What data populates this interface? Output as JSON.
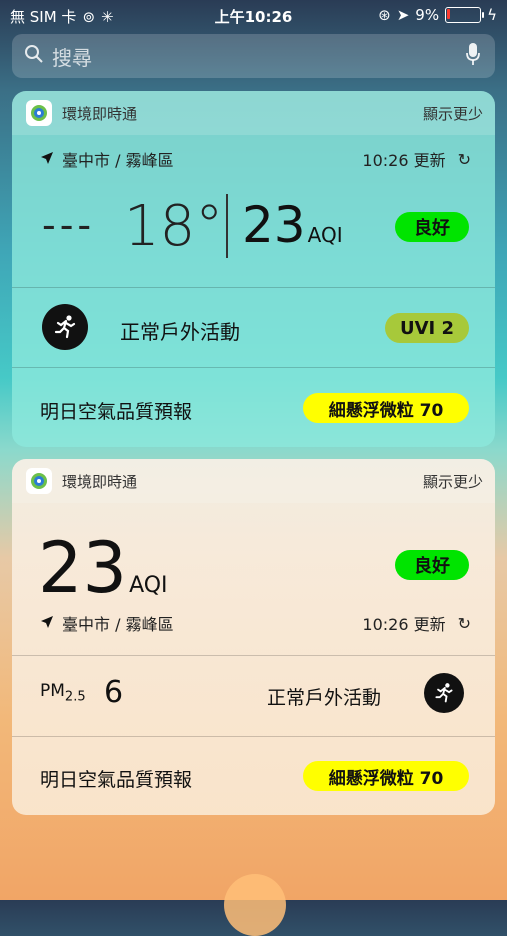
{
  "status": {
    "carrier": "無 SIM 卡",
    "time": "上午10:26",
    "battery": "9%",
    "battery_level": 0.09
  },
  "search": {
    "placeholder": "搜尋"
  },
  "widget1": {
    "app_name": "環境即時通",
    "show_less": "顯示更少",
    "location": "臺中市 / 霧峰區",
    "updated": "10:26 更新",
    "temp_placeholder": "---",
    "temperature": "18°",
    "aqi_value": "23",
    "aqi_unit": "AQI",
    "aqi_status": "良好",
    "activity": "正常戶外活動",
    "uvi": "UVI 2",
    "tomorrow_label": "明日空氣品質預報",
    "tomorrow_value": "細懸浮微粒 70"
  },
  "widget2": {
    "app_name": "環境即時通",
    "show_less": "顯示更少",
    "aqi_value": "23",
    "aqi_unit": "AQI",
    "aqi_status": "良好",
    "location": "臺中市 / 霧峰區",
    "updated": "10:26 更新",
    "pm_label": "PM",
    "pm_sub": "2.5",
    "pm_value": "6",
    "activity": "正常戶外活動",
    "tomorrow_label": "明日空氣品質預報",
    "tomorrow_value": "細懸浮微粒 70"
  },
  "colors": {
    "good": "#00e400",
    "uvi": "#a7c93a",
    "pm": "#ffff00"
  }
}
